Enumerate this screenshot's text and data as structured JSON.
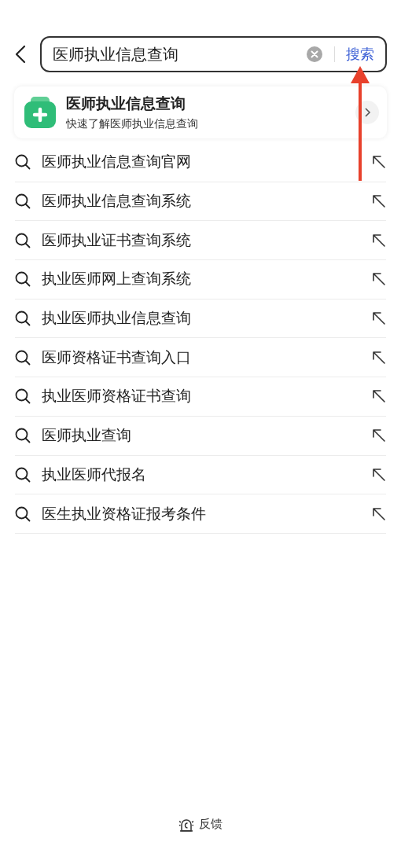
{
  "search": {
    "value": "医师执业信息查询",
    "button": "搜索"
  },
  "card": {
    "title": "医师执业信息查询",
    "subtitle": "快速了解医师执业信息查询"
  },
  "suggestions": [
    {
      "text": "医师执业信息查询官网"
    },
    {
      "text": "医师执业信息查询系统"
    },
    {
      "text": "医师执业证书查询系统"
    },
    {
      "text": "执业医师网上查询系统"
    },
    {
      "text": "执业医师执业信息查询"
    },
    {
      "text": "医师资格证书查询入口"
    },
    {
      "text": "执业医师资格证书查询"
    },
    {
      "text": "医师执业查询"
    },
    {
      "text": "执业医师代报名"
    },
    {
      "text": "医生执业资格证报考条件"
    }
  ],
  "footer": {
    "label": "反馈"
  }
}
